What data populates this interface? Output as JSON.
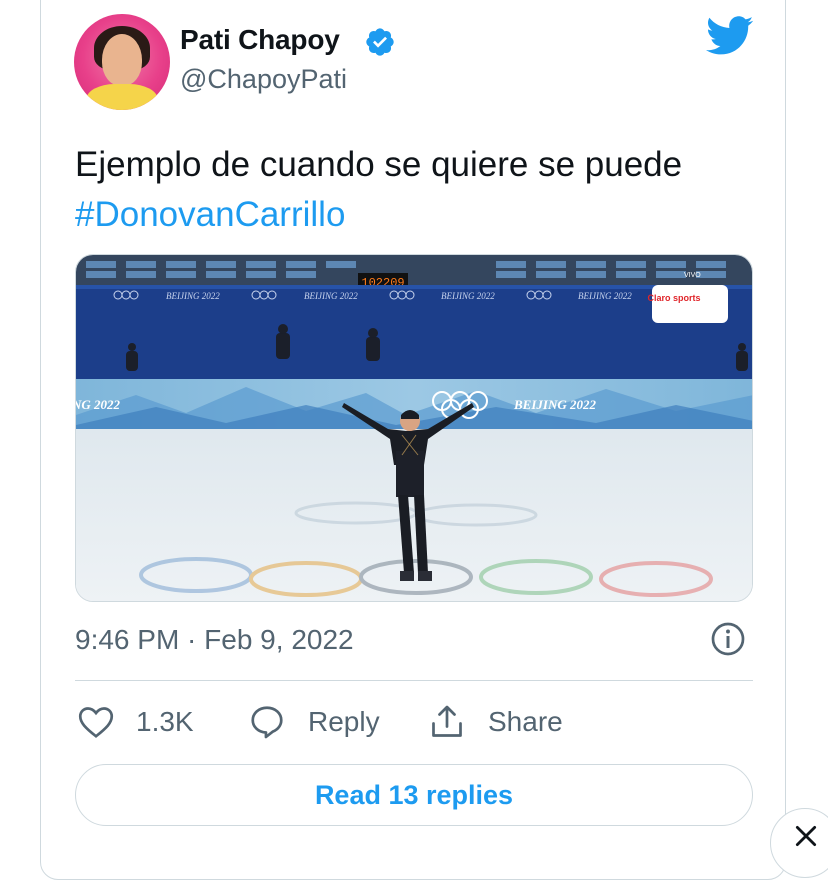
{
  "tweet": {
    "author_name": "Pati Chapoy",
    "author_handle": "@ChapoyPati",
    "text": "Ejemplo de cuando se quiere se puede",
    "hashtag": "#DonovanCarrillo",
    "timestamp": "9:46 PM · Feb 9, 2022",
    "media": {
      "scoreboard": "102209",
      "banner_text": "BEIJING 2022",
      "banner_text_left": "NG 2022",
      "sponsor_text": "Claro sports",
      "live_text": "VIVO",
      "board_text": "BEIJING 2022"
    }
  },
  "actions": {
    "likes": "1.3K",
    "reply": "Reply",
    "share": "Share",
    "read_replies": "Read 13 replies"
  },
  "colors": {
    "accent": "#1d9bf0",
    "secondary_text": "#536471",
    "border": "#cfd9de"
  },
  "icons": [
    "twitter-bird-icon",
    "verified-badge-icon",
    "info-icon",
    "heart-icon",
    "reply-bubble-icon",
    "share-icon",
    "close-icon"
  ]
}
